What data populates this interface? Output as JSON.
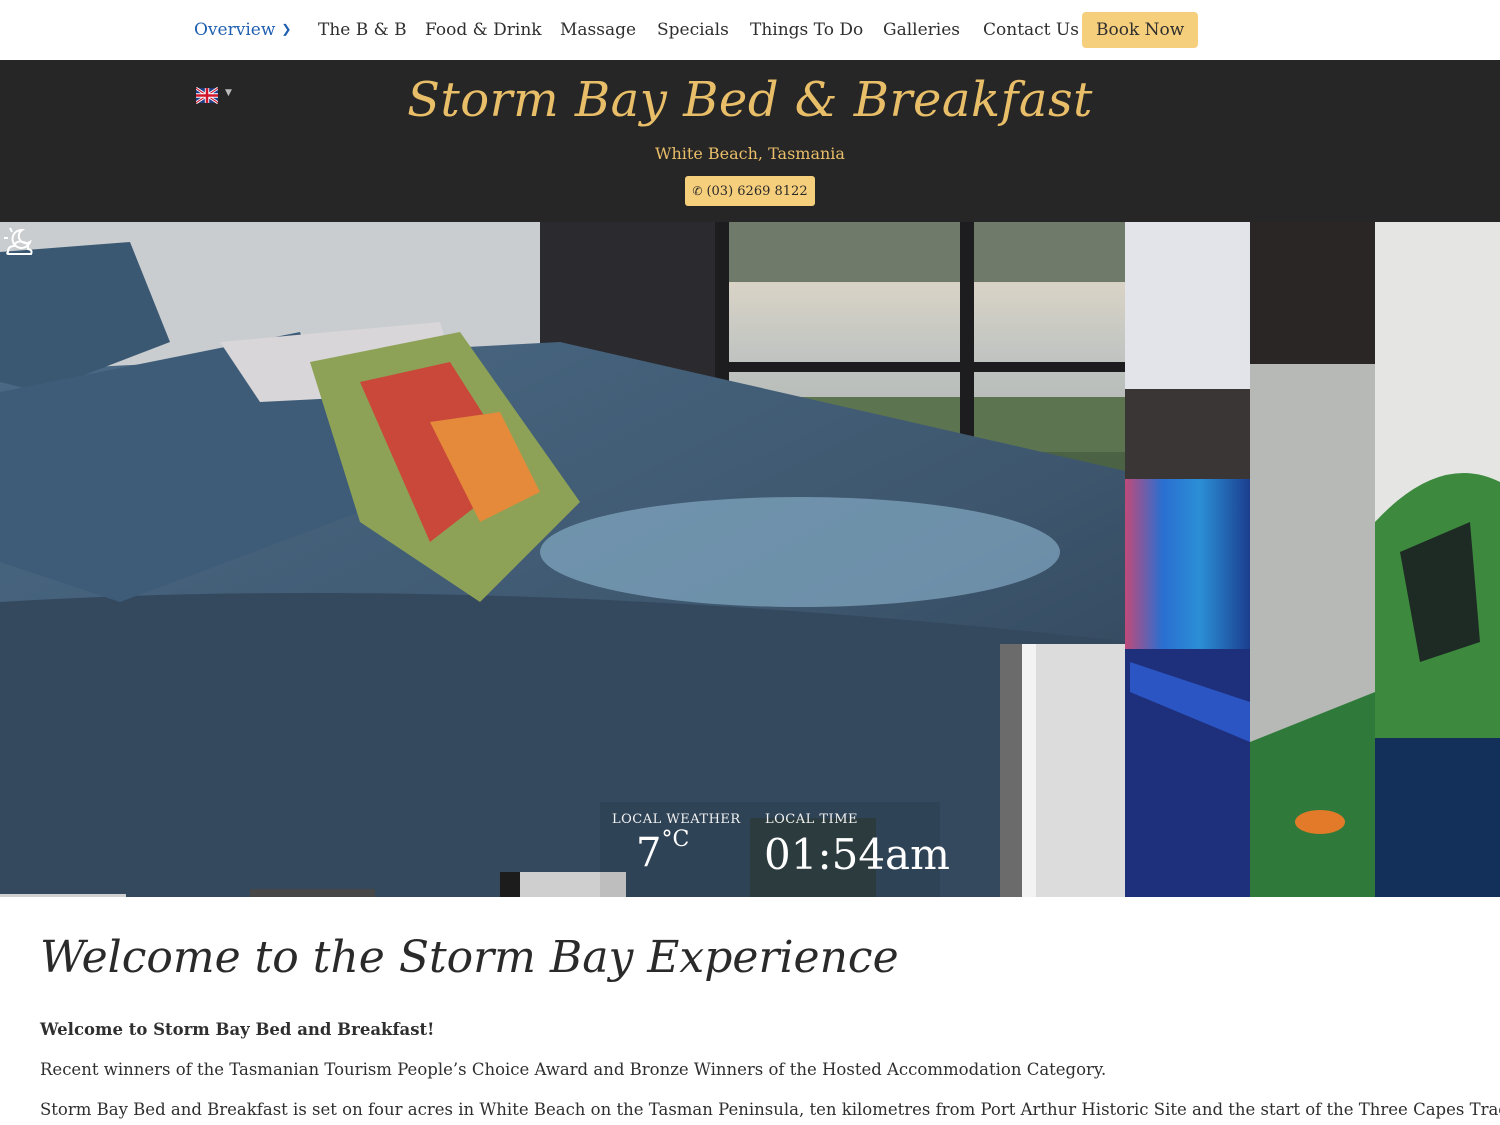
{
  "nav": {
    "items": [
      {
        "label": "Overview",
        "active": true
      },
      {
        "label": "The B & B"
      },
      {
        "label": "Food & Drink"
      },
      {
        "label": "Massage"
      },
      {
        "label": "Specials"
      },
      {
        "label": "Things To Do"
      },
      {
        "label": "Galleries"
      },
      {
        "label": "Contact Us"
      }
    ],
    "book_label": "Book Now"
  },
  "header": {
    "title": "Storm Bay Bed & Breakfast",
    "subtitle": "White Beach, Tasmania",
    "phone": "(03) 6269 8122",
    "language_icon": "uk-flag-icon"
  },
  "hero": {
    "weather_label": "LOCAL WEATHER",
    "temperature": "7",
    "temperature_unit": "°C",
    "weather_icon": "partly-cloudy-night-icon",
    "time_label": "LOCAL TIME",
    "time": "01:54am"
  },
  "content": {
    "heading": "Welcome to the Storm Bay Experience",
    "paragraphs": [
      "Welcome to Storm Bay Bed and Breakfast!",
      "Recent winners of the Tasmanian Tourism People’s Choice Award and Bronze Winners of the Hosted Accommodation Category.",
      "Storm Bay Bed and Breakfast is set on four acres in White Beach on the Tasman Peninsula, ten kilometres from Port Arthur Historic Site and the start of the Three Capes Track."
    ]
  },
  "colors": {
    "accent_gold": "#e9be69",
    "button_gold": "#f6cf7c",
    "band_dark": "#262626",
    "nav_active": "#1f5fb0"
  }
}
